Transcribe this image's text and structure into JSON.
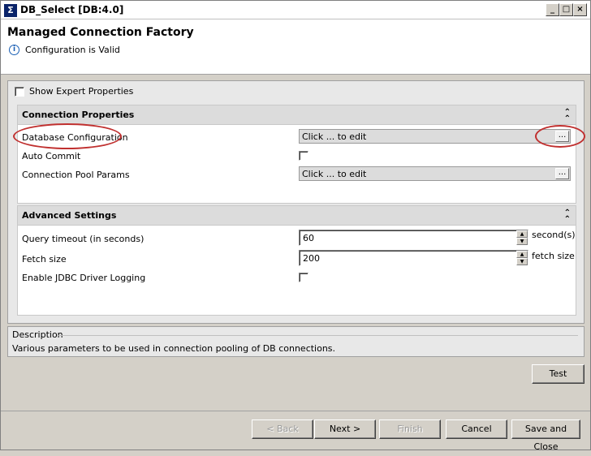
{
  "window": {
    "title": "DB_Select [DB:4.0]",
    "controls": [
      "_",
      "□",
      "×"
    ]
  },
  "header": {
    "title": "Managed Connection Factory",
    "status": "Configuration is Valid",
    "status_icon": "info-icon"
  },
  "options": {
    "show_expert_label": "Show Expert Properties",
    "show_expert_checked": false
  },
  "connection_properties": {
    "title": "Connection Properties",
    "rows": [
      {
        "label": "Database Configuration",
        "value": "Click ... to edit",
        "button": "..."
      },
      {
        "label": "Auto Commit",
        "checked": false
      },
      {
        "label": "Connection Pool Params",
        "value": "Click ... to edit",
        "button": "..."
      }
    ]
  },
  "advanced_settings": {
    "title": "Advanced Settings",
    "rows": [
      {
        "label": "Query timeout (in seconds)",
        "value": "60",
        "unit": "second(s)"
      },
      {
        "label": "Fetch size",
        "value": "200",
        "unit": "fetch size"
      },
      {
        "label": "Enable JDBC Driver Logging",
        "checked": false
      }
    ]
  },
  "description": {
    "title": "Description",
    "text": "Various parameters to be used in connection pooling of DB connections."
  },
  "buttons": {
    "test": "Test",
    "back": "< Back",
    "next": "Next >",
    "finish": "Finish",
    "cancel": "Cancel",
    "save_close": "Save and Close"
  },
  "colors": {
    "annotation": "#c0302f",
    "info": "#1a5fb4"
  }
}
